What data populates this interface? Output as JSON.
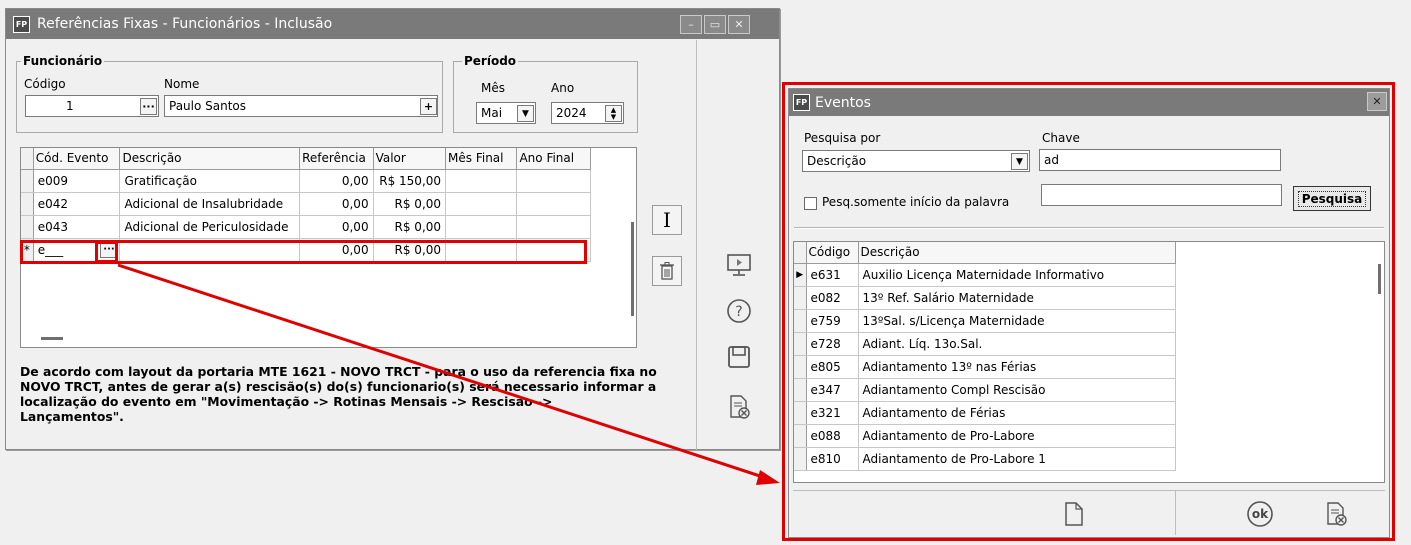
{
  "main": {
    "title": "Referências Fixas - Funcionários - Inclusão",
    "app_badge": "FP",
    "funcionario": {
      "group_label": "Funcionário",
      "codigo_label": "Código",
      "nome_label": "Nome",
      "codigo_value": "1",
      "nome_value": "Paulo Santos"
    },
    "periodo": {
      "group_label": "Período",
      "mes_label": "Mês",
      "ano_label": "Ano",
      "mes_value": "Mai",
      "ano_value": "2024"
    },
    "grid": {
      "columns": [
        "Cód. Evento",
        "Descrição",
        "Referência",
        "Valor",
        "Mês Final",
        "Ano Final"
      ],
      "rows": [
        {
          "cod": "e009",
          "desc": "Gratificação",
          "ref": "0,00",
          "valor": "R$ 150,00",
          "mes": "",
          "ano": ""
        },
        {
          "cod": "e042",
          "desc": "Adicional de Insalubridade",
          "ref": "0,00",
          "valor": "R$ 0,00",
          "mes": "",
          "ano": ""
        },
        {
          "cod": "e043",
          "desc": "Adicional de Periculosidade",
          "ref": "0,00",
          "valor": "R$ 0,00",
          "mes": "",
          "ano": ""
        },
        {
          "cod": "e___",
          "desc": "",
          "ref": "0,00",
          "valor": "R$ 0,00",
          "mes": "",
          "ano": "",
          "indicator": "*"
        }
      ]
    },
    "note": "De acordo com layout da portaria MTE 1621 - NOVO TRCT - para o uso da referencia fixa no NOVO TRCT, antes de gerar a(s) rescisão(s) do(s) funcionario(s) será necessario informar a localização do evento em \"Movimentação -> Rotinas Mensais -> Rescisão -> Lançamentos\"."
  },
  "eventos": {
    "title": "Eventos",
    "app_badge": "FP",
    "pesquisa_por_label": "Pesquisa por",
    "pesquisa_por_value": "Descrição",
    "chave_label": "Chave",
    "chave_value": "ad",
    "checkbox_label": "Pesq.somente início da palavra",
    "pesquisa_button": "Pesquisa",
    "ok_label": "ok",
    "columns": [
      "Código",
      "Descrição"
    ],
    "rows": [
      {
        "cod": "e631",
        "desc": "Auxilio Licença Maternidade Informativo",
        "indicator": "▶"
      },
      {
        "cod": "e082",
        "desc": "13º Ref. Salário Maternidade",
        "indicator": ""
      },
      {
        "cod": "e759",
        "desc": "13ºSal. s/Licença Maternidade",
        "indicator": ""
      },
      {
        "cod": "e728",
        "desc": "Adiant. Líq. 13o.Sal.",
        "indicator": ""
      },
      {
        "cod": "e805",
        "desc": "Adiantamento 13º nas Férias",
        "indicator": ""
      },
      {
        "cod": "e347",
        "desc": "Adiantamento Compl Rescisão",
        "indicator": ""
      },
      {
        "cod": "e321",
        "desc": "Adiantamento de Férias",
        "indicator": ""
      },
      {
        "cod": "e088",
        "desc": "Adiantamento de Pro-Labore",
        "indicator": ""
      },
      {
        "cod": "e810",
        "desc": "Adiantamento de Pro-Labore 1",
        "indicator": ""
      }
    ]
  },
  "colors": {
    "highlight": "#e00000",
    "titlebar": "#7a7a7a"
  }
}
